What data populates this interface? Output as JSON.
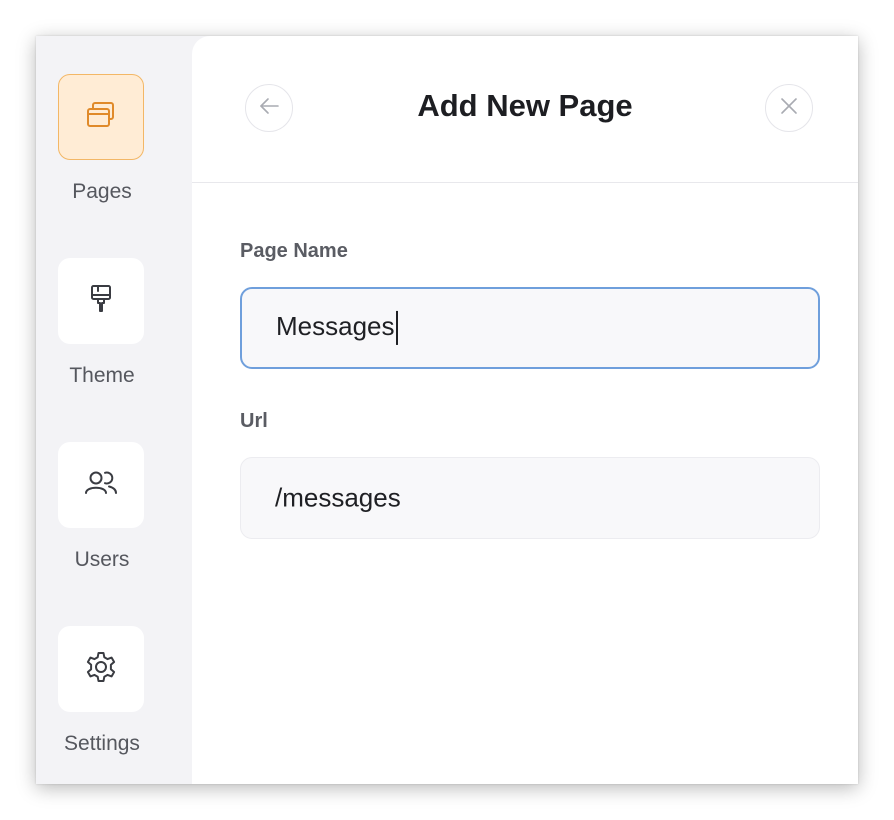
{
  "sidebar": {
    "items": [
      {
        "label": "Pages",
        "icon": "pages-icon",
        "active": true
      },
      {
        "label": "Theme",
        "icon": "paint-brush-icon",
        "active": false
      },
      {
        "label": "Users",
        "icon": "users-icon",
        "active": false
      },
      {
        "label": "Settings",
        "icon": "gear-icon",
        "active": false
      }
    ]
  },
  "header": {
    "title": "Add New Page",
    "back_icon": "arrow-left-icon",
    "close_icon": "close-icon"
  },
  "form": {
    "page_name": {
      "label": "Page Name",
      "value": "Messages"
    },
    "url": {
      "label": "Url",
      "value": "/messages"
    }
  },
  "colors": {
    "active_tile_bg": "#ffecd5",
    "active_tile_border": "#f3b766",
    "active_icon": "#e08a2a",
    "focus_border": "#6f9fdc"
  }
}
